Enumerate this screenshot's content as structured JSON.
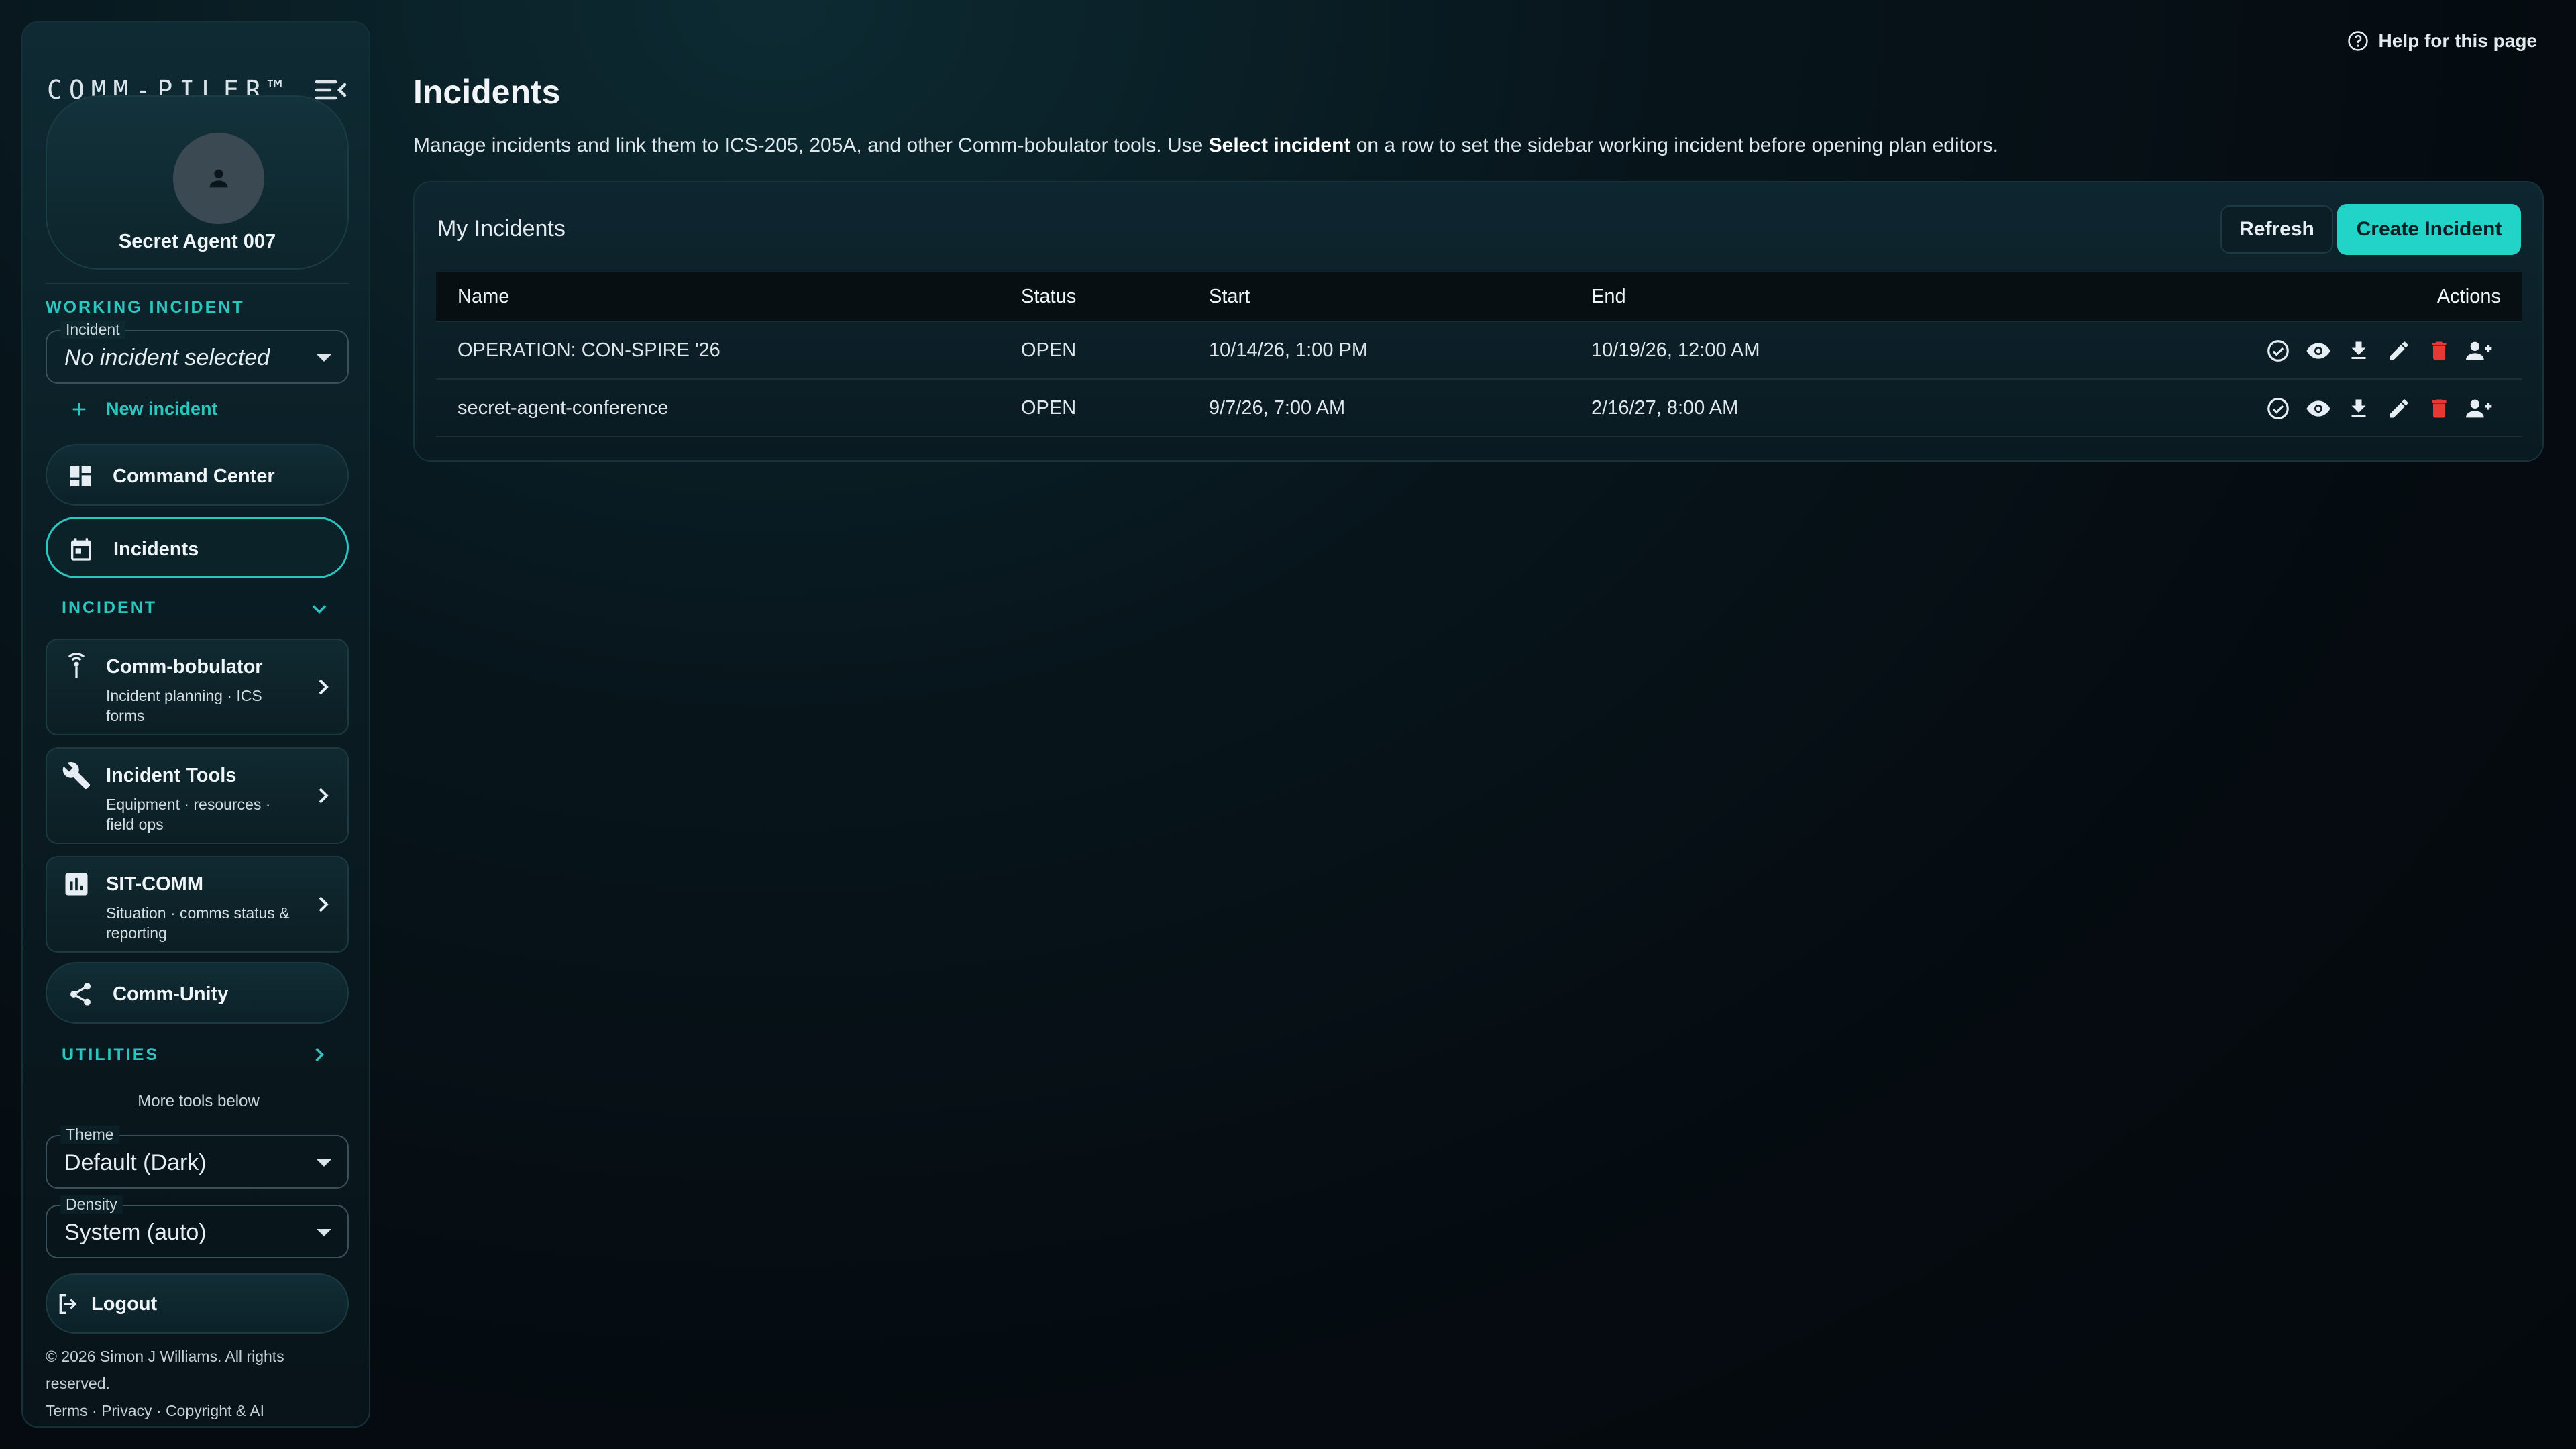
{
  "brand": "COMM-PILER™",
  "profile": {
    "name": "Secret Agent 007"
  },
  "working_incident": {
    "section_label": "WORKING INCIDENT",
    "field_label": "Incident",
    "value": "No incident selected",
    "new_label": "New incident"
  },
  "nav": {
    "command_center": "Command Center",
    "incidents": "Incidents",
    "comm_unity": "Comm-Unity"
  },
  "incident_section": {
    "label": "INCIDENT"
  },
  "tools": [
    {
      "title": "Comm-bobulator",
      "sub": "Incident planning · ICS forms"
    },
    {
      "title": "Incident Tools",
      "sub": "Equipment · resources · field ops"
    },
    {
      "title": "SIT-COMM",
      "sub": "Situation · comms status & reporting"
    }
  ],
  "utilities": {
    "label": "UTILITIES",
    "more": "More tools below"
  },
  "theme": {
    "label": "Theme",
    "value": "Default (Dark)"
  },
  "density": {
    "label": "Density",
    "value": "System (auto)"
  },
  "logout": "Logout",
  "footer": {
    "copyright": "© 2026 Simon J Williams. All rights reserved.",
    "terms": "Terms",
    "privacy": "Privacy",
    "copyright_ai": "Copyright & AI",
    "sep": " · "
  },
  "help": "Help for this page",
  "page": {
    "title": "Incidents",
    "desc_before": "Manage incidents and link them to ICS-205, 205A, and other Comm-bobulator tools. Use ",
    "desc_bold": "Select incident",
    "desc_after": " on a row to set the sidebar working incident before opening plan editors."
  },
  "panel": {
    "title": "My Incidents",
    "refresh": "Refresh",
    "create": "Create Incident"
  },
  "table": {
    "headers": {
      "name": "Name",
      "status": "Status",
      "start": "Start",
      "end": "End",
      "actions": "Actions"
    },
    "rows": [
      {
        "name": "OPERATION: CON-SPIRE '26",
        "status": "OPEN",
        "start": "10/14/26, 1:00 PM",
        "end": "10/19/26, 12:00 AM"
      },
      {
        "name": "secret-agent-conference",
        "status": "OPEN",
        "start": "9/7/26, 7:00 AM",
        "end": "2/16/27, 8:00 AM"
      }
    ]
  },
  "colors": {
    "accent": "#22d3c8",
    "danger": "#e53935",
    "background": "#050b10"
  },
  "icons": [
    "menu-collapse-icon",
    "person-icon",
    "plus-icon",
    "dashboard-icon",
    "calendar-icon",
    "chevron-down-icon",
    "antenna-icon",
    "wrench-icon",
    "chart-icon",
    "chevron-right-icon",
    "share-icon",
    "logout-icon",
    "help-circle-icon",
    "check-circle-icon",
    "eye-icon",
    "download-icon",
    "pencil-icon",
    "trash-icon",
    "person-add-icon"
  ]
}
